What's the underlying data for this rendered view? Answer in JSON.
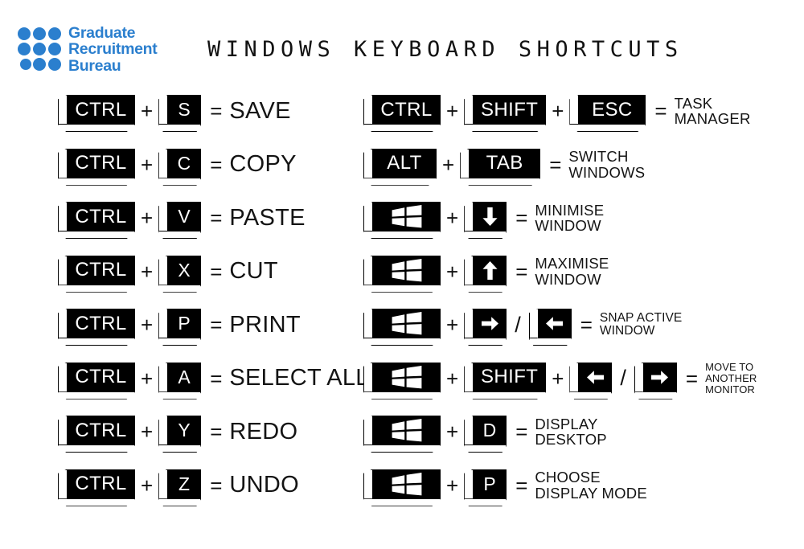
{
  "page": {
    "background": "#ffffff",
    "title": "WINDOWS KEYBOARD SHORTCUTS",
    "title_color": "#121212"
  },
  "logo": {
    "brand_color": "#2b7fce",
    "line1": "Graduate",
    "line2": "Recruitment",
    "line3": "Bureau",
    "dot_count": 9
  },
  "operators": {
    "plus": "+",
    "equals": "=",
    "slash": "/"
  },
  "icons": {
    "windows": "windows-flag-icon",
    "arrow_down": "arrow-down-icon",
    "arrow_up": "arrow-up-icon",
    "arrow_left": "arrow-left-icon",
    "arrow_right": "arrow-right-icon"
  },
  "left_column": [
    {
      "keys": [
        "CTRL",
        "S"
      ],
      "action": "SAVE"
    },
    {
      "keys": [
        "CTRL",
        "C"
      ],
      "action": "COPY"
    },
    {
      "keys": [
        "CTRL",
        "V"
      ],
      "action": "PASTE"
    },
    {
      "keys": [
        "CTRL",
        "X"
      ],
      "action": "CUT"
    },
    {
      "keys": [
        "CTRL",
        "P"
      ],
      "action": "PRINT"
    },
    {
      "keys": [
        "CTRL",
        "A"
      ],
      "action": "SELECT ALL"
    },
    {
      "keys": [
        "CTRL",
        "Y"
      ],
      "action": "REDO"
    },
    {
      "keys": [
        "CTRL",
        "Z"
      ],
      "action": "UNDO"
    }
  ],
  "right_column": [
    {
      "keys": [
        "CTRL",
        "SHIFT",
        "ESC"
      ],
      "action": "TASK\nMANAGER"
    },
    {
      "keys": [
        "ALT",
        "TAB"
      ],
      "action": "SWITCH\nWINDOWS"
    },
    {
      "keys": [
        "WIN",
        "DOWN"
      ],
      "action": "MINIMISE\nWINDOW"
    },
    {
      "keys": [
        "WIN",
        "UP"
      ],
      "action": "MAXIMISE\nWINDOW"
    },
    {
      "keys": [
        "WIN",
        "RIGHT",
        "LEFT"
      ],
      "action": "SNAP ACTIVE\nWINDOW"
    },
    {
      "keys": [
        "WIN",
        "SHIFT",
        "LEFT",
        "RIGHT"
      ],
      "action": "MOVE TO\nANOTHER\nMONITOR"
    },
    {
      "keys": [
        "WIN",
        "D"
      ],
      "action": "DISPLAY\nDESKTOP"
    },
    {
      "keys": [
        "WIN",
        "P"
      ],
      "action": "CHOOSE\nDISPLAY MODE"
    }
  ]
}
